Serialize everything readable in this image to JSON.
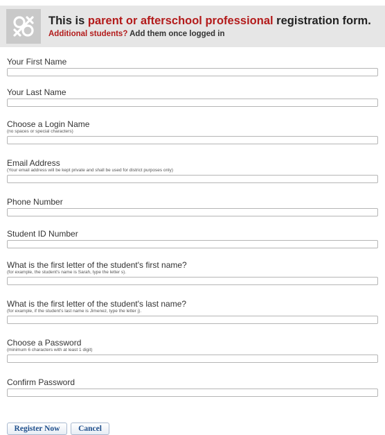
{
  "header": {
    "title_prefix": "This is ",
    "title_accent": "parent or afterschool professional",
    "title_suffix": " registration form.",
    "subtitle_accent": "Additional students?",
    "subtitle_rest": " Add them once logged in",
    "accent_color": "#b31b1b",
    "logo_icon": "knot-logo-icon"
  },
  "fields": [
    {
      "label": "Your First Name",
      "hint": "",
      "value": ""
    },
    {
      "label": "Your Last Name",
      "hint": "",
      "value": ""
    },
    {
      "label": "Choose a Login Name",
      "hint": "(no spaces or special characters)",
      "value": ""
    },
    {
      "label": "Email Address",
      "hint": "(Your email address will be kept private and shall be used for district purposes only)",
      "value": ""
    },
    {
      "label": "Phone Number",
      "hint": "",
      "value": ""
    },
    {
      "label": "Student ID Number",
      "hint": "",
      "value": ""
    },
    {
      "label": "What is the first letter of the student's first name?",
      "hint": "(for example, the student's name is Sarah, type the letter s).",
      "value": ""
    },
    {
      "label": "What is the first letter of the student's last name?",
      "hint": "(for example, if the student's last name is Jimenez, type the letter j).",
      "value": ""
    },
    {
      "label": "Choose a Password",
      "hint": "(minimum 6 characters with at least 1 digit)",
      "value": ""
    },
    {
      "label": "Confirm Password",
      "hint": "",
      "value": ""
    }
  ],
  "buttons": {
    "register_label": "Register Now",
    "cancel_label": "Cancel"
  }
}
